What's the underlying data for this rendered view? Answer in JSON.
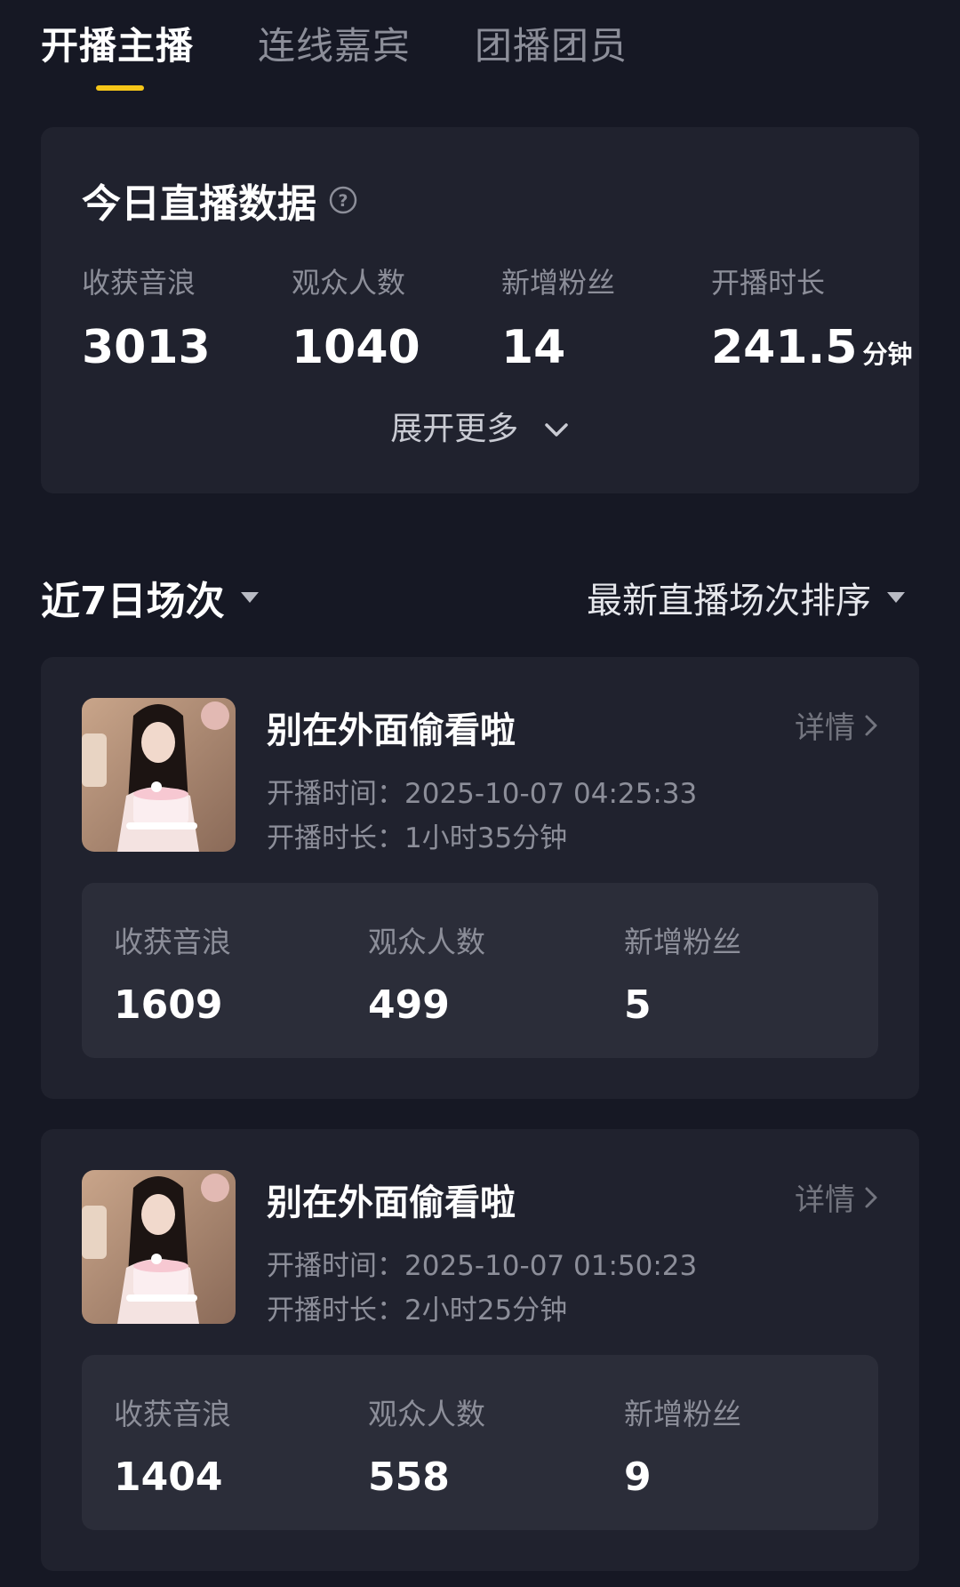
{
  "tabs": [
    {
      "label": "开播主播",
      "active": true
    },
    {
      "label": "连线嘉宾",
      "active": false
    },
    {
      "label": "团播团员",
      "active": false
    }
  ],
  "today": {
    "title": "今日直播数据",
    "stats": [
      {
        "label": "收获音浪",
        "value": "3013"
      },
      {
        "label": "观众人数",
        "value": "1040"
      },
      {
        "label": "新增粉丝",
        "value": "14"
      },
      {
        "label": "开播时长",
        "value": "241.5",
        "unit": "分钟"
      }
    ],
    "expand_label": "展开更多"
  },
  "section": {
    "range_label": "近7日场次",
    "sort_label": "最新直播场次排序"
  },
  "sessions": [
    {
      "title": "别在外面偷看啦",
      "detail_label": "详情",
      "start_time": "开播时间：2025-10-07 04:25:33",
      "duration": "开播时长：1小时35分钟",
      "stats": [
        {
          "label": "收获音浪",
          "value": "1609"
        },
        {
          "label": "观众人数",
          "value": "499"
        },
        {
          "label": "新增粉丝",
          "value": "5"
        }
      ]
    },
    {
      "title": "别在外面偷看啦",
      "detail_label": "详情",
      "start_time": "开播时间：2025-10-07 01:50:23",
      "duration": "开播时长：2小时25分钟",
      "stats": [
        {
          "label": "收获音浪",
          "value": "1404"
        },
        {
          "label": "观众人数",
          "value": "558"
        },
        {
          "label": "新增粉丝",
          "value": "9"
        }
      ]
    }
  ],
  "colors": {
    "background": "#161824",
    "card": "#20222e",
    "inner_card": "#2b2d39",
    "accent": "#f5c518",
    "muted_text": "#8c8e99"
  }
}
